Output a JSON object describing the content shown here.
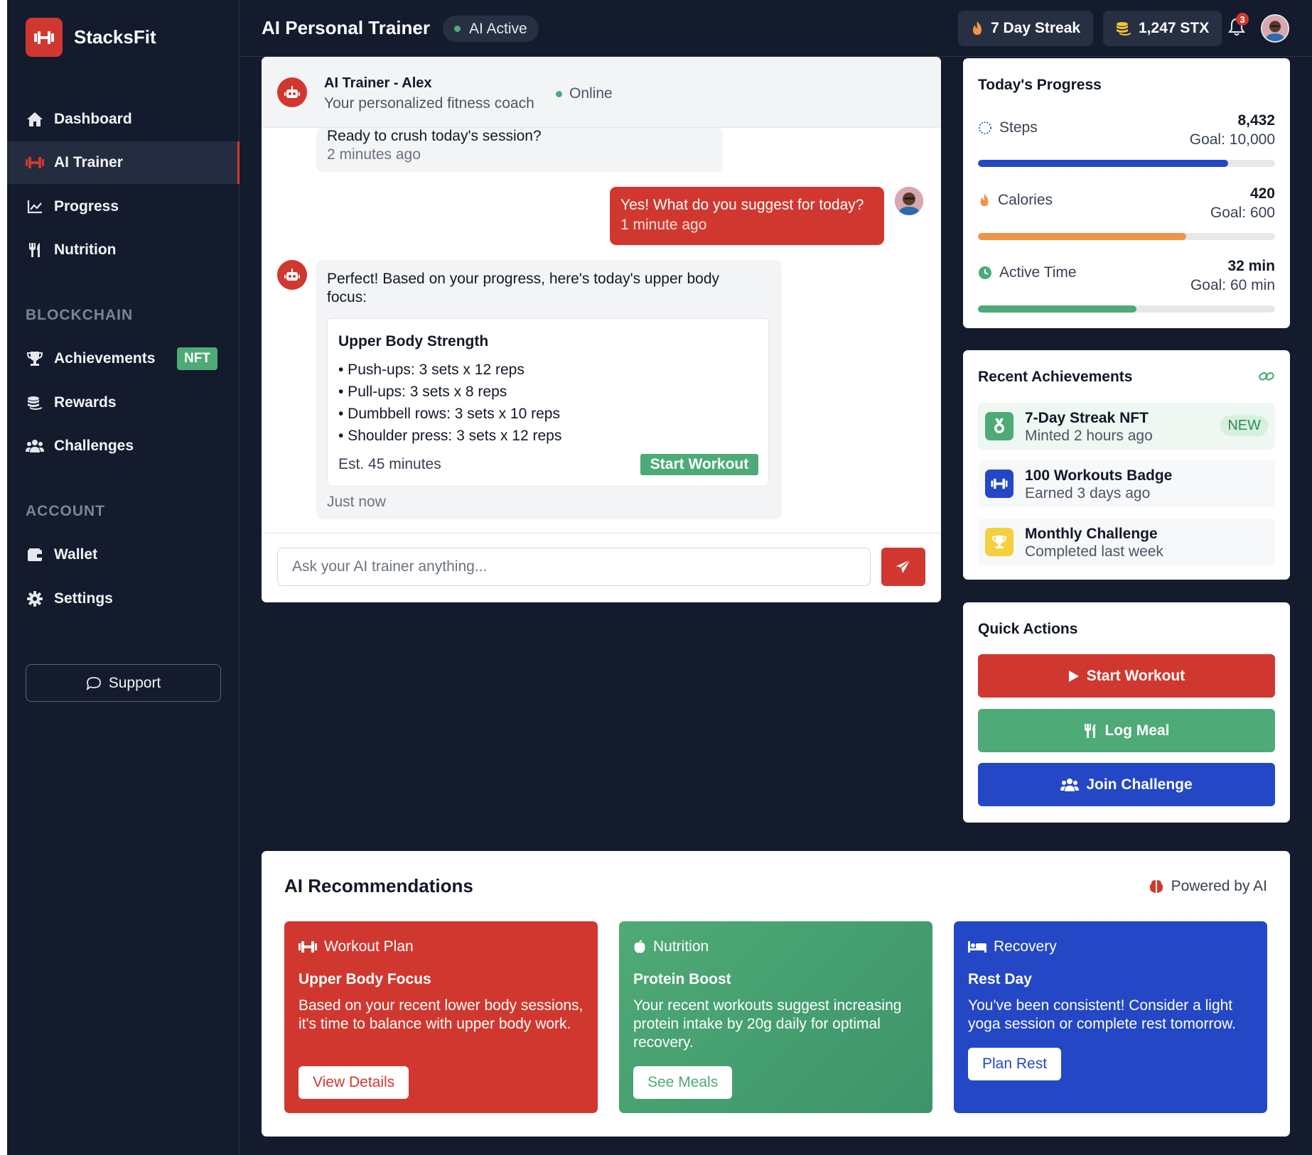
{
  "brand": {
    "name": "StacksFit"
  },
  "sidebar": {
    "items": [
      {
        "label": "Dashboard",
        "icon": "home-icon"
      },
      {
        "label": "AI Trainer",
        "icon": "dumbbell-icon"
      },
      {
        "label": "Progress",
        "icon": "chart-line-icon"
      },
      {
        "label": "Nutrition",
        "icon": "utensils-icon"
      }
    ],
    "blockchain_section": "BLOCKCHAIN",
    "blockchain_items": [
      {
        "label": "Achievements",
        "icon": "trophy-icon",
        "badge": "NFT"
      },
      {
        "label": "Rewards",
        "icon": "coins-icon"
      },
      {
        "label": "Challenges",
        "icon": "users-icon"
      }
    ],
    "account_section": "ACCOUNT",
    "account_items": [
      {
        "label": "Wallet",
        "icon": "wallet-icon"
      },
      {
        "label": "Settings",
        "icon": "gear-icon"
      }
    ],
    "support_label": "Support"
  },
  "header": {
    "title": "AI Personal Trainer",
    "status_pill": "AI Active",
    "streak": "7 Day Streak",
    "balance": "1,247 STX",
    "notification_count": "3"
  },
  "chat": {
    "trainer_name": "AI Trainer - Alex",
    "trainer_subtitle": "Your personalized fitness coach",
    "status": "Online",
    "messages": [
      {
        "from": "bot",
        "text": "Ready to crush today's session?",
        "time": "2 minutes ago"
      },
      {
        "from": "user",
        "text": "Yes! What do you suggest for today?",
        "time": "1 minute ago"
      },
      {
        "from": "bot",
        "text_line1": "Perfect! Based on your progress, here's today's upper body",
        "text_line2": "focus:",
        "time": "Just now"
      }
    ],
    "workout": {
      "title": "Upper Body Strength",
      "exercises": [
        "• Push-ups: 3 sets x 12 reps",
        "• Pull-ups: 3 sets x 8 reps",
        "• Dumbbell rows: 3 sets x 10 reps",
        "• Shoulder press: 3 sets x 12 reps"
      ],
      "estimate": "Est. 45 minutes",
      "start_label": "Start Workout"
    },
    "input_placeholder": "Ask your AI trainer anything..."
  },
  "progress": {
    "title": "Today's Progress",
    "metrics": [
      {
        "label": "Steps",
        "value": "8,432",
        "goal": "Goal: 10,000",
        "fraction": 0.8432,
        "color": "#2347c5",
        "icon": "shoe-prints-icon"
      },
      {
        "label": "Calories",
        "value": "420",
        "goal": "Goal: 600",
        "fraction": 0.7,
        "color": "#ef9548",
        "icon": "fire-icon"
      },
      {
        "label": "Active Time",
        "value": "32 min",
        "goal": "Goal: 60 min",
        "fraction": 0.5333,
        "color": "#4eaa76",
        "icon": "clock-icon"
      }
    ]
  },
  "achievements": {
    "title": "Recent Achievements",
    "items": [
      {
        "name": "7-Day Streak NFT",
        "sub": "Minted 2 hours ago",
        "badge": "NEW",
        "icon": "medal-icon",
        "color": "#4eaa76"
      },
      {
        "name": "100 Workouts Badge",
        "sub": "Earned 3 days ago",
        "icon": "dumbbell-icon",
        "color": "#2347c5"
      },
      {
        "name": "Monthly Challenge",
        "sub": "Completed last week",
        "icon": "trophy-icon",
        "color": "#f4d03f"
      }
    ]
  },
  "quick_actions": {
    "title": "Quick Actions",
    "buttons": [
      {
        "label": "Start Workout",
        "color": "#d0382f",
        "icon": "play-icon"
      },
      {
        "label": "Log Meal",
        "color": "#4eaa76",
        "icon": "utensils-icon"
      },
      {
        "label": "Join Challenge",
        "color": "#2347c5",
        "icon": "users-icon"
      }
    ]
  },
  "recommendations": {
    "title": "AI Recommendations",
    "powered_by": "Powered by AI",
    "cards": [
      {
        "category": "Workout Plan",
        "name": "Upper Body Focus",
        "desc": "Based on your recent lower body sessions, it's time to balance with upper body work.",
        "button": "View Details",
        "color": "#d0382f",
        "icon": "dumbbell-icon"
      },
      {
        "category": "Nutrition",
        "name": "Protein Boost",
        "desc": "Your recent workouts suggest increasing protein intake by 20g daily for optimal recovery.",
        "button": "See Meals",
        "color": "#4eaa76",
        "icon": "apple-icon"
      },
      {
        "category": "Recovery",
        "name": "Rest Day",
        "desc": "You've been consistent! Consider a light yoga session or complete rest tomorrow.",
        "button": "Plan Rest",
        "color": "#2347c5",
        "icon": "bed-icon"
      }
    ]
  },
  "colors": {
    "accent": "#d0382f",
    "success": "#4eaa76",
    "primary_blue": "#2347c5",
    "sidebar_bg": "#141b2d"
  }
}
